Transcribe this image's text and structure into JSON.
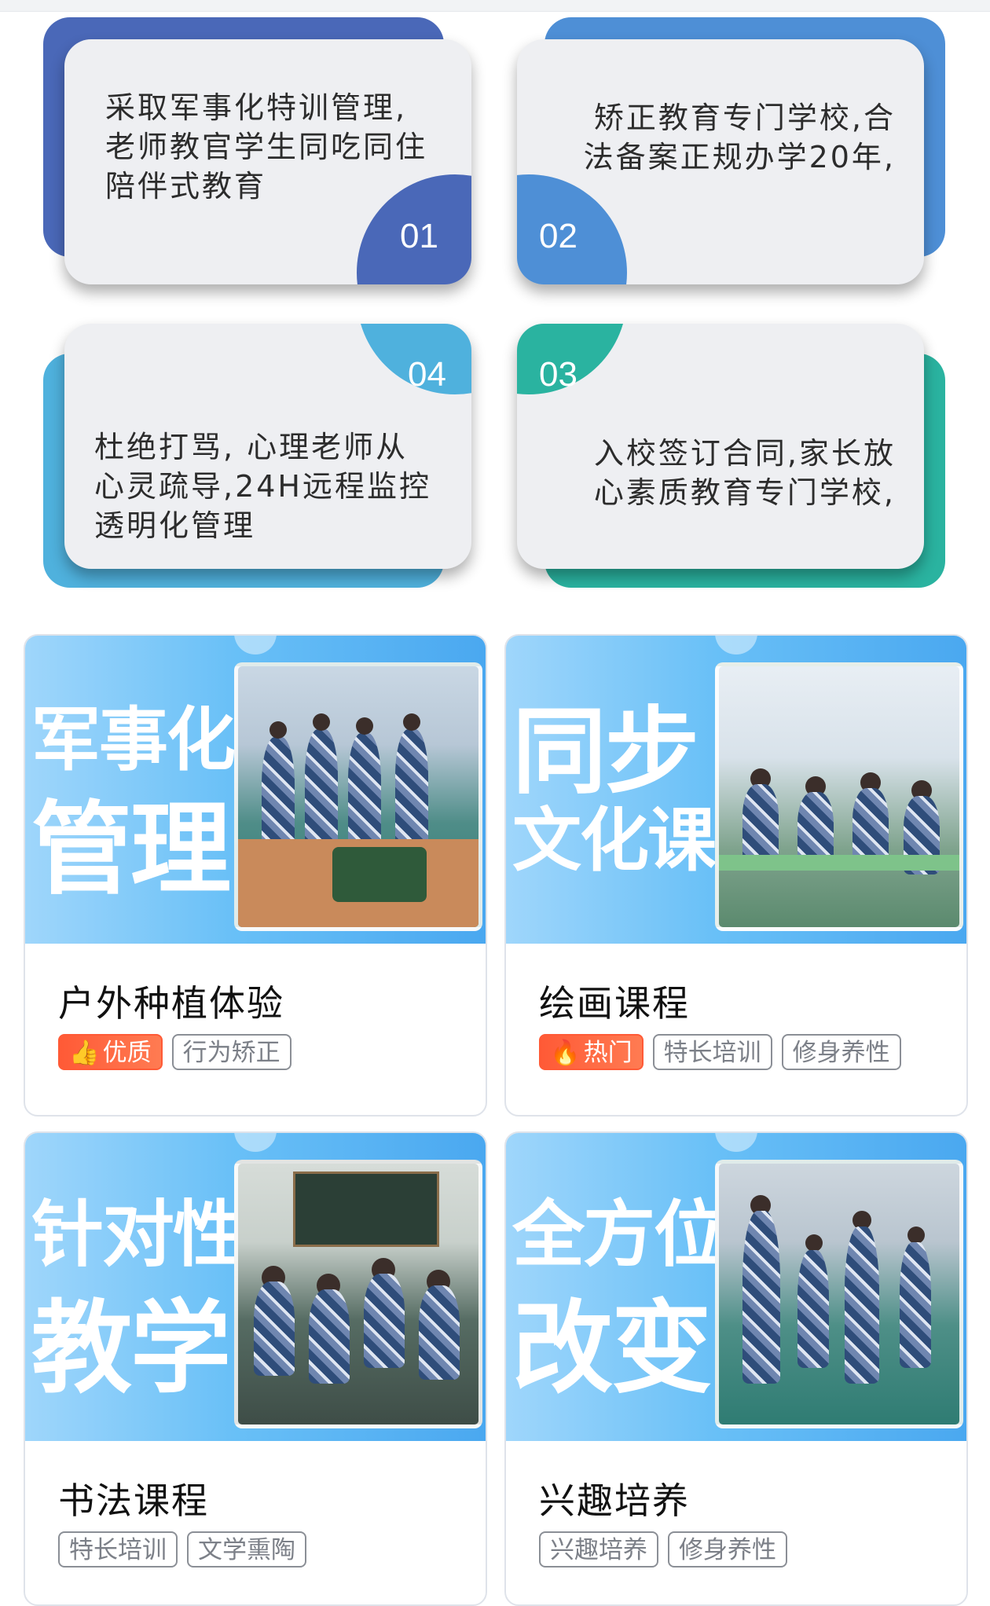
{
  "features": [
    {
      "num": "01",
      "lines": [
        "采取军事化特训管理,",
        "老师教官学生同吃同住",
        "陪伴式教育"
      ],
      "color": "#4a68b8"
    },
    {
      "num": "02",
      "lines": [
        "矫正教育专门学校,合",
        "法备案正规办学20年,"
      ],
      "color": "#4e8fd6"
    },
    {
      "num": "04",
      "lines": [
        "杜绝打骂, 心理老师从",
        "心灵疏导,24H远程监控",
        "透明化管理"
      ],
      "color": "#4fb1dd"
    },
    {
      "num": "03",
      "lines": [
        "入校签订合同,家长放",
        "心素质教育专门学校,"
      ],
      "color": "#2ab3a0"
    }
  ],
  "courses": [
    {
      "banner": [
        "军事化",
        "管理"
      ],
      "title": "户外种植体验",
      "tags": [
        {
          "label": "优质",
          "hot": true,
          "icon": "thumbs-up-icon"
        },
        {
          "label": "行为矫正",
          "hot": false
        }
      ]
    },
    {
      "banner": [
        "同步",
        "文化课"
      ],
      "title": "绘画课程",
      "tags": [
        {
          "label": "热门",
          "hot": true,
          "icon": "fire-icon"
        },
        {
          "label": "特长培训",
          "hot": false
        },
        {
          "label": "修身养性",
          "hot": false
        }
      ]
    },
    {
      "banner": [
        "针对性",
        "教学"
      ],
      "title": "书法课程",
      "tags": [
        {
          "label": "特长培训",
          "hot": false
        },
        {
          "label": "文学熏陶",
          "hot": false
        }
      ]
    },
    {
      "banner": [
        "全方位",
        "改变"
      ],
      "title": "兴趣培养",
      "tags": [
        {
          "label": "兴趣培养",
          "hot": false
        },
        {
          "label": "修身养性",
          "hot": false
        }
      ]
    }
  ]
}
